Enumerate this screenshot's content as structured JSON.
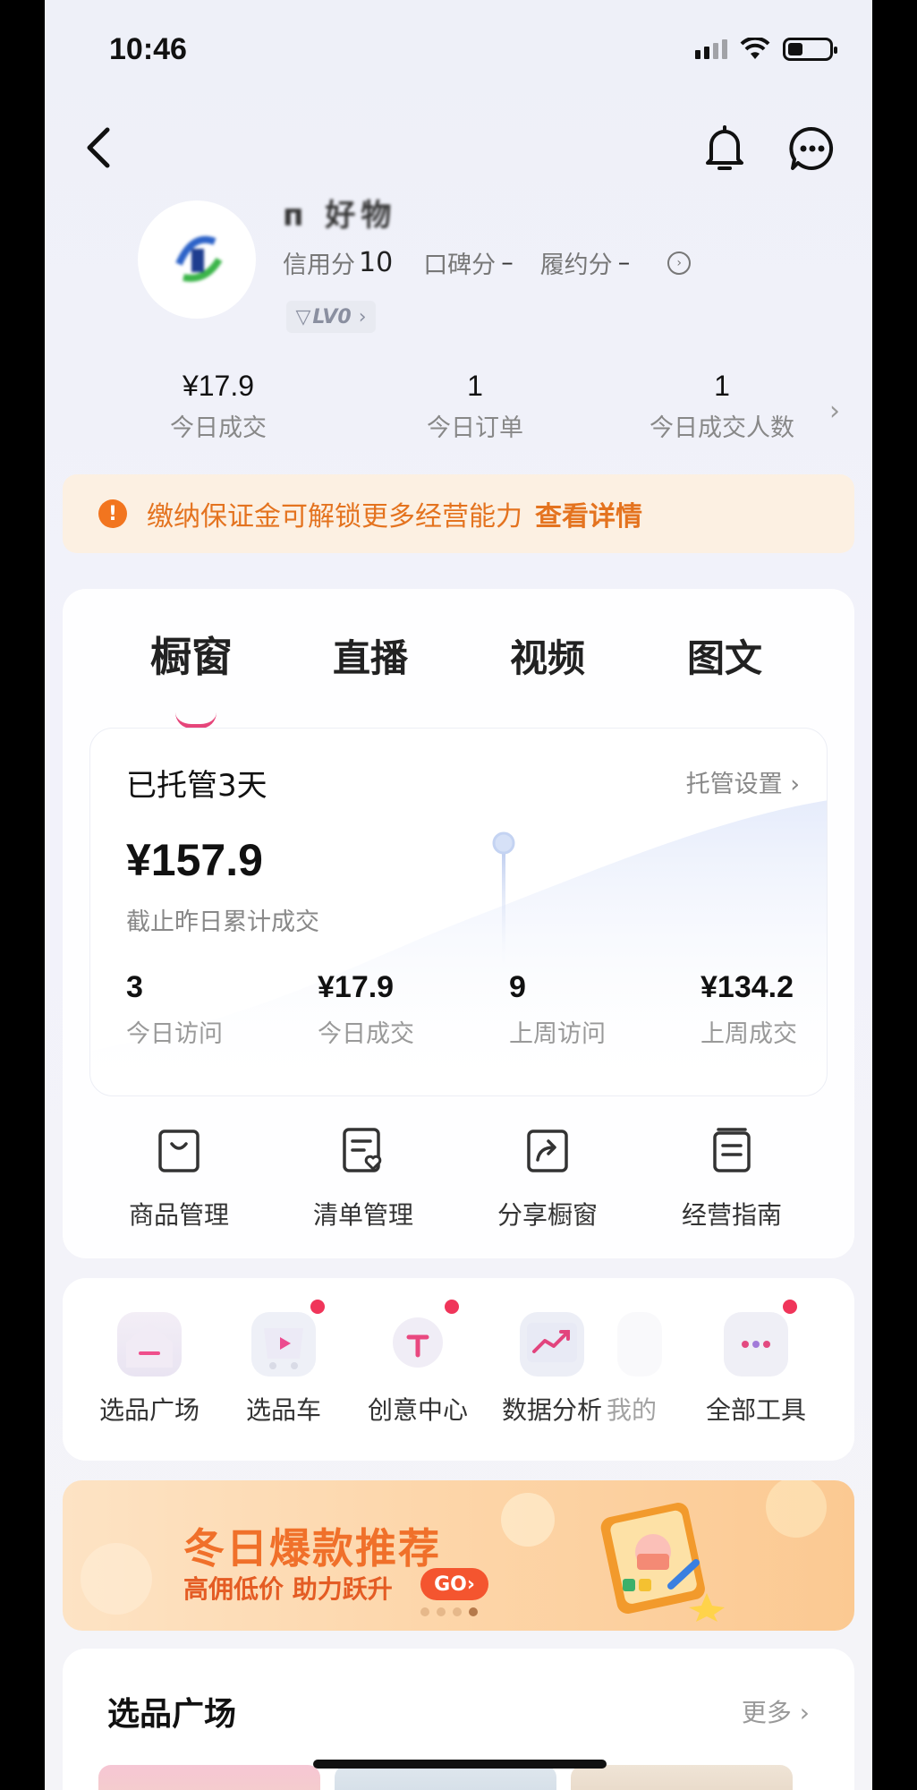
{
  "status_bar": {
    "time": "10:46"
  },
  "profile": {
    "shop_name": "п 好物",
    "credit_label": "信用分",
    "credit_value": "10",
    "reputation_label": "口碑分",
    "reputation_value": "–",
    "fulfillment_label": "履约分",
    "fulfillment_value": "–",
    "level": "LV0",
    "level_arrow": "›"
  },
  "today_stats": [
    {
      "value": "¥17.9",
      "label": "今日成交"
    },
    {
      "value": "1",
      "label": "今日订单"
    },
    {
      "value": "1",
      "label": "今日成交人数"
    }
  ],
  "deposit_banner": {
    "text": "缴纳保证金可解锁更多经营能力",
    "link": "查看详情"
  },
  "tabs": [
    {
      "label": "橱窗",
      "active": true
    },
    {
      "label": "直播",
      "active": false
    },
    {
      "label": "视频",
      "active": false
    },
    {
      "label": "图文",
      "active": false
    }
  ],
  "managed": {
    "title": "已托管3天",
    "settings": "托管设置 ›",
    "total_amount": "¥157.9",
    "total_label": "截止昨日累计成交",
    "stats": [
      {
        "value": "3",
        "label": "今日访问"
      },
      {
        "value": "¥17.9",
        "label": "今日成交"
      },
      {
        "value": "9",
        "label": "上周访问"
      },
      {
        "value": "¥134.2",
        "label": "上周成交"
      }
    ]
  },
  "shop_tools": [
    {
      "label": "商品管理",
      "icon": "bag-icon"
    },
    {
      "label": "清单管理",
      "icon": "list-heart-icon"
    },
    {
      "label": "分享橱窗",
      "icon": "share-icon"
    },
    {
      "label": "经营指南",
      "icon": "guide-icon"
    }
  ],
  "quick_tools": [
    {
      "label": "选品广场",
      "icon": "house-icon",
      "badge": false
    },
    {
      "label": "选品车",
      "icon": "cart-icon",
      "badge": true
    },
    {
      "label": "创意中心",
      "icon": "bulb-icon",
      "badge": true
    },
    {
      "label": "数据分析",
      "icon": "chart-icon",
      "badge": false
    },
    {
      "label": "我的",
      "icon": "faded-icon",
      "badge": false
    },
    {
      "label": "全部工具",
      "icon": "more-dots-icon",
      "badge": true
    }
  ],
  "promo": {
    "title": "冬日爆款推荐",
    "subtitle": "高佣低价 助力跃升",
    "go": "GO›",
    "pages": 4,
    "active_page": 4
  },
  "section": {
    "title": "选品广场",
    "more": "更多 ›"
  },
  "colors": {
    "accent_pink": "#e6457a",
    "warning_orange": "#f2751f",
    "badge_red": "#f0355a"
  }
}
